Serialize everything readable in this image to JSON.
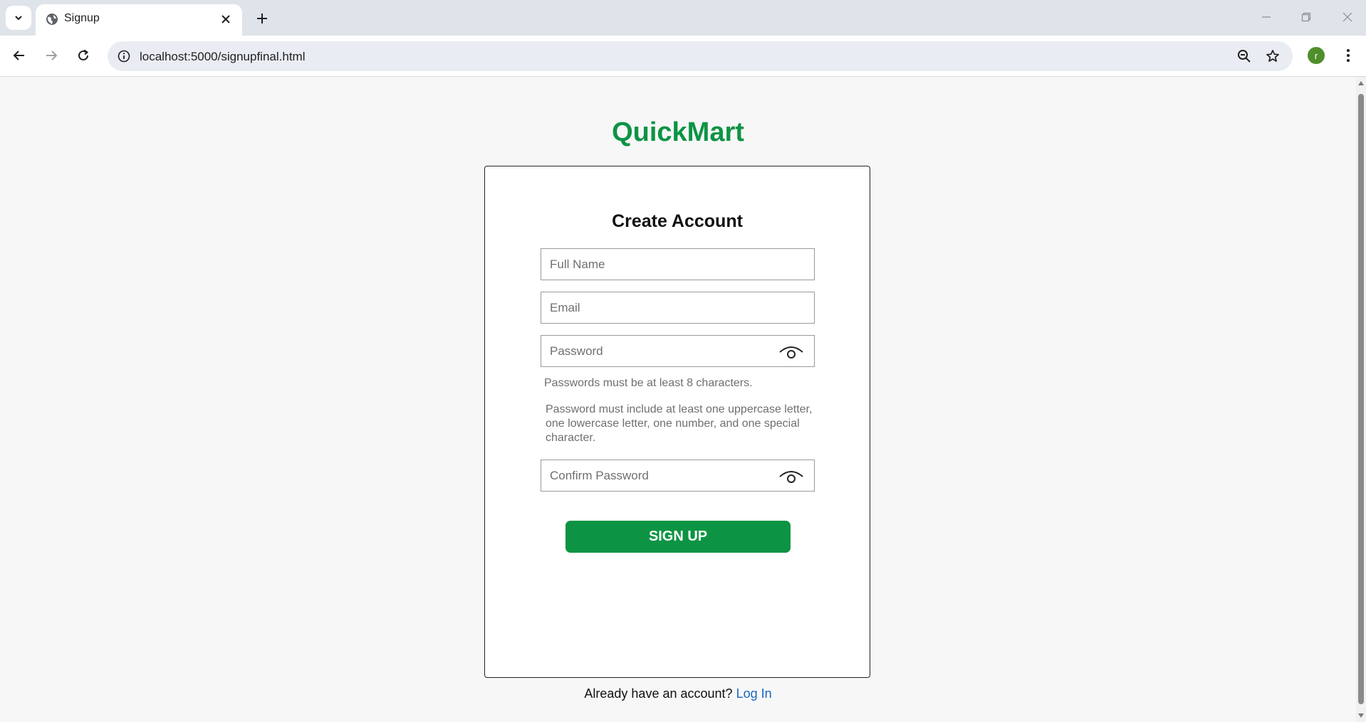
{
  "browser": {
    "tab_title": "Signup",
    "url": "localhost:5000/signupfinal.html",
    "profile_initial": "r"
  },
  "page": {
    "brand": "QuickMart",
    "form_title": "Create Account",
    "fields": {
      "full_name_placeholder": "Full Name",
      "email_placeholder": "Email",
      "password_placeholder": "Password",
      "confirm_password_placeholder": "Confirm Password"
    },
    "password_hint_length": "Passwords must be at least 8 characters.",
    "password_hint_complexity": "Password must include at least one uppercase letter, one lowercase letter, one number, and one special character.",
    "signup_button": "SIGN UP",
    "footer_question": "Already have an account?",
    "login_link": "Log In"
  },
  "colors": {
    "brand_green": "#0c9444",
    "link_blue": "#1a66c2"
  },
  "icons": [
    "tab-search-icon",
    "globe-icon",
    "close-icon",
    "plus-icon",
    "minimize-icon",
    "restore-icon",
    "window-close-icon",
    "back-arrow-icon",
    "forward-arrow-icon",
    "reload-icon",
    "site-info-icon",
    "zoom-icon",
    "star-icon",
    "kebab-menu-icon",
    "eye-icon"
  ]
}
